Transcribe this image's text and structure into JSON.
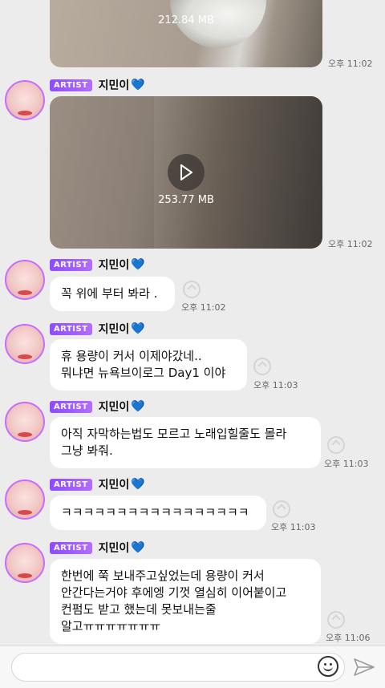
{
  "messages": [
    {
      "type": "video",
      "size": "212.84 MB",
      "time": "오후 11:02"
    },
    {
      "type": "video",
      "badge": "ARTIST",
      "sender": "지민이",
      "heart": "💙",
      "size": "253.77 MB",
      "time": "오후 11:02"
    },
    {
      "type": "text",
      "badge": "ARTIST",
      "sender": "지민이",
      "heart": "💙",
      "text": "꼭 위에 부터 봐라 .",
      "time": "오후 11:02"
    },
    {
      "type": "text",
      "badge": "ARTIST",
      "sender": "지민이",
      "heart": "💙",
      "text": "휴 용량이 커서 이제야갔네..\n뭐냐면 뉴욕브이로그 Day1 이야",
      "time": "오후 11:03"
    },
    {
      "type": "text",
      "badge": "ARTIST",
      "sender": "지민이",
      "heart": "💙",
      "text": "아직 자막하는법도 모르고 노래입힐줄도 몰라\n그냥 봐줘.",
      "time": "오후 11:03"
    },
    {
      "type": "text",
      "badge": "ARTIST",
      "sender": "지민이",
      "heart": "💙",
      "text": "ㅋㅋㅋㅋㅋㅋㅋㅋㅋㅋㅋㅋㅋㅋㅋㅋㅋ",
      "time": "오후 11:03"
    },
    {
      "type": "text",
      "badge": "ARTIST",
      "sender": "지민이",
      "heart": "💙",
      "text": "한번에 쭉 보내주고싶었는데 용량이 커서\n안간다는거야 후에엥 기껏 열심히 이어붙이고\n컨펌도 받고 했는데 못보내는줄\n알고ㅠㅠㅠㅠㅠㅠㅠ",
      "time": "오후 11:06"
    }
  ],
  "icons": {
    "share": "share-icon",
    "play": "play-icon",
    "emoji": "emoji-icon",
    "send": "send-icon"
  },
  "colors": {
    "badge": "#9b59ff",
    "avatar_ring": "#c86cff",
    "background": "#ececec"
  }
}
